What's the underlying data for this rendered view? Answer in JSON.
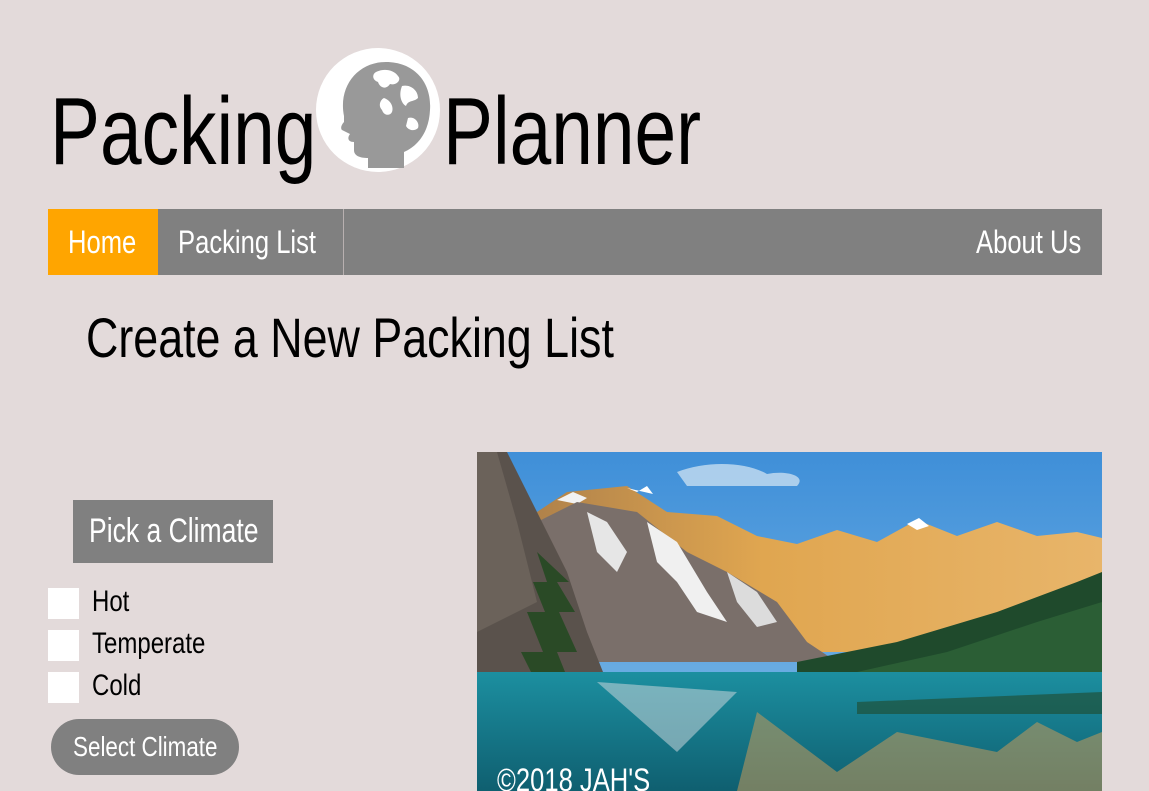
{
  "logo": {
    "word1": "Packing",
    "word2": "Planner",
    "head_icon": "globe-head-icon"
  },
  "nav": {
    "home": "Home",
    "packing_list": "Packing List",
    "about_us": "About Us",
    "active": "Home"
  },
  "main": {
    "title": "Create a New Packing List"
  },
  "climate": {
    "badge": "Pick a Climate",
    "options": [
      "Hot",
      "Temperate",
      "Cold"
    ],
    "button": "Select Climate"
  },
  "image": {
    "caption": "©2018 JAH'S"
  },
  "colors": {
    "background": "#e3dada",
    "accent": "#ffa500",
    "nav_gray": "#808080"
  }
}
